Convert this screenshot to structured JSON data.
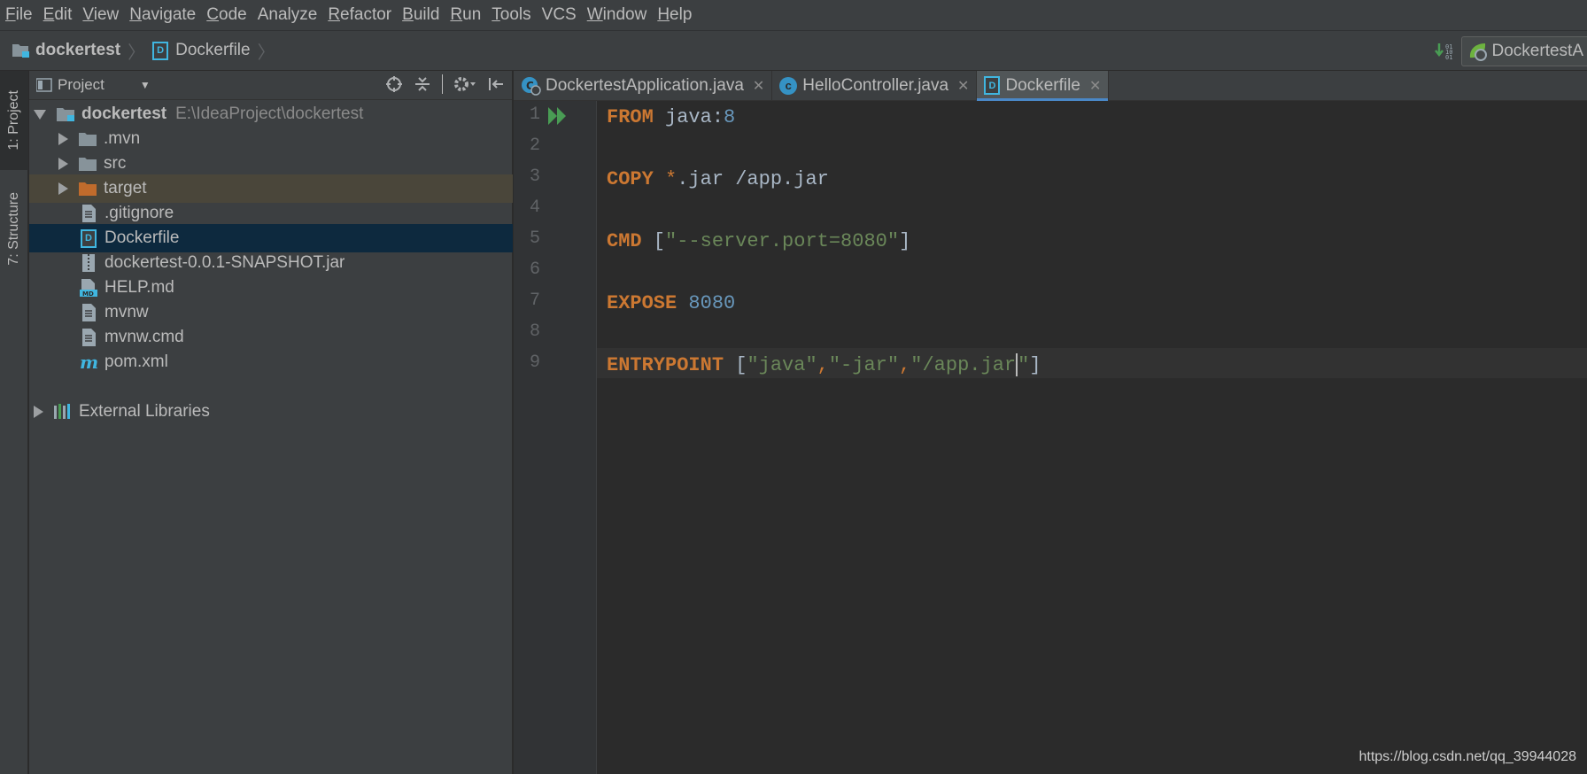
{
  "menu": [
    {
      "u": "F",
      "rest": "ile"
    },
    {
      "u": "E",
      "rest": "dit"
    },
    {
      "u": "V",
      "rest": "iew"
    },
    {
      "u": "N",
      "rest": "avigate"
    },
    {
      "u": "C",
      "rest": "ode"
    },
    {
      "u": "",
      "rest": "Analyze"
    },
    {
      "u": "R",
      "rest": "efactor"
    },
    {
      "u": "B",
      "rest": "uild"
    },
    {
      "u": "R",
      "rest": "un"
    },
    {
      "u": "T",
      "rest": "ools"
    },
    {
      "u": "",
      "rest": "VCS"
    },
    {
      "u": "W",
      "rest": "indow"
    },
    {
      "u": "H",
      "rest": "elp"
    }
  ],
  "navbar": {
    "project": "dockertest",
    "file": "Dockerfile",
    "run_config": "DockertestA"
  },
  "toolstrip": {
    "project_tab": "1: Project",
    "structure_tab": "7: Structure"
  },
  "project_panel": {
    "title": "Project",
    "root_name": "dockertest",
    "root_path": "E:\\IdeaProject\\dockertest",
    "items": [
      {
        "label": ".mvn",
        "kind": "folder"
      },
      {
        "label": "src",
        "kind": "folder"
      },
      {
        "label": "target",
        "kind": "folder-excluded"
      },
      {
        "label": ".gitignore",
        "kind": "file"
      },
      {
        "label": "Dockerfile",
        "kind": "docker"
      },
      {
        "label": "dockertest-0.0.1-SNAPSHOT.jar",
        "kind": "jar"
      },
      {
        "label": "HELP.md",
        "kind": "md"
      },
      {
        "label": "mvnw",
        "kind": "file"
      },
      {
        "label": "mvnw.cmd",
        "kind": "file"
      },
      {
        "label": "pom.xml",
        "kind": "maven"
      }
    ],
    "external_libraries": "External Libraries"
  },
  "tabs": [
    {
      "label": "DockertestApplication.java",
      "icon": "spring-boot-class-icon",
      "active": false
    },
    {
      "label": "HelloController.java",
      "icon": "class-icon",
      "active": false
    },
    {
      "label": "Dockerfile",
      "icon": "docker-file-icon",
      "active": true
    }
  ],
  "editor": {
    "line_numbers": [
      "1",
      "2",
      "3",
      "4",
      "5",
      "6",
      "7",
      "8",
      "9"
    ],
    "code": {
      "l1_kw": "FROM",
      "l1_img": " java:",
      "l1_tag": "8",
      "l3_kw": "COPY",
      "l3_star": " *",
      "l3_rest": ".jar /app.jar",
      "l5_kw": "CMD",
      "l5_open": " [",
      "l5_str": "\"--server.port=8080\"",
      "l5_close": "]",
      "l7_kw": "EXPOSE",
      "l7_num": " 8080",
      "l9_kw": "ENTRYPOINT",
      "l9_open": " [",
      "l9_s1": "\"java\"",
      "l9_c1": ",",
      "l9_s2": "\"-jar\"",
      "l9_c2": ",",
      "l9_s3a": "\"/app.jar",
      "l9_s3b": "\"",
      "l9_close": "]"
    }
  },
  "watermark": "https://blog.csdn.net/qq_39944028",
  "colors": {
    "keyword": "#cc7832",
    "string": "#6a8759",
    "number": "#6897bb",
    "selection": "#0d293e",
    "excluded_folder": "#c06b2c",
    "folder": "#87939a",
    "run_gutter": "#499c54"
  }
}
